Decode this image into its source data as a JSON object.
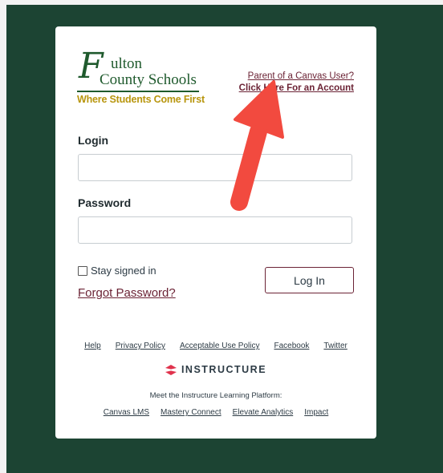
{
  "colors": {
    "background": "#1c4433",
    "card": "#ffffff",
    "link": "#6b2335",
    "logo_green": "#1f5a2d",
    "logo_gold": "#b8960e",
    "annotation_arrow": "#f24a3f"
  },
  "logo": {
    "initial": "F",
    "line1": "ulton",
    "line2": "County Schools",
    "tagline": "Where Students Come First"
  },
  "header_links": {
    "parent": "Parent of a Canvas User?",
    "account": "Click Here For an Account"
  },
  "form": {
    "login_label": "Login",
    "login_value": "",
    "password_label": "Password",
    "password_value": "",
    "stay_signed_in": "Stay signed in",
    "stay_signed_in_checked": false,
    "forgot_password": "Forgot Password?",
    "login_button": "Log In"
  },
  "footer": {
    "links": [
      "Help",
      "Privacy Policy",
      "Acceptable Use Policy",
      "Facebook",
      "Twitter"
    ],
    "brand_icon": "instructure-logo-icon",
    "brand": "INSTRUCTURE",
    "platform_text": "Meet the Instructure Learning Platform:",
    "platform_links": [
      "Canvas LMS",
      "Mastery Connect",
      "Elevate Analytics",
      "Impact"
    ]
  },
  "annotation": {
    "icon": "red-arrow-icon",
    "points_to": "Click Here For an Account"
  }
}
